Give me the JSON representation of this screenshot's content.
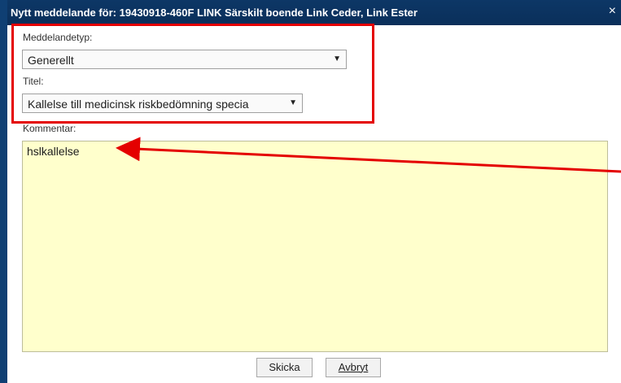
{
  "window": {
    "title": "Nytt meddelande för: 19430918-460F LINK Särskilt boende Link Ceder, Link Ester",
    "close_icon": "×"
  },
  "form": {
    "message_type_label": "Meddelandetyp:",
    "message_type_value": "Generellt",
    "title_label": "Titel:",
    "title_value": "Kallelse till medicinsk riskbedömning specia",
    "comment_label": "Kommentar:",
    "comment_value": "hslkallelse"
  },
  "buttons": {
    "send_label": "Skicka",
    "cancel_label": "Avbryt"
  },
  "annotation": {
    "highlight_color": "#e40000"
  }
}
